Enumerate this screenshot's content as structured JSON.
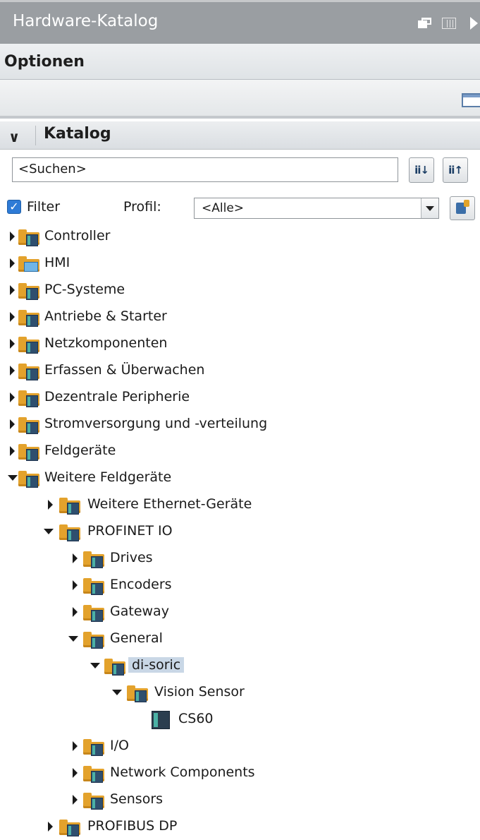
{
  "titlebar": {
    "title": "Hardware-Katalog",
    "icons": [
      "restore-icon",
      "columns-icon",
      "collapse-right-icon"
    ]
  },
  "options": {
    "header": "Optionen"
  },
  "catalog": {
    "header": "Katalog",
    "search": {
      "value": "<Suchen>"
    },
    "filter": {
      "checked": true,
      "label": "Filter"
    },
    "profile": {
      "label": "Profil:",
      "value": "<Alle>"
    }
  },
  "tree": {
    "items": [
      {
        "label": "Controller"
      },
      {
        "label": "HMI"
      },
      {
        "label": "PC-Systeme"
      },
      {
        "label": "Antriebe & Starter"
      },
      {
        "label": "Netzkomponenten"
      },
      {
        "label": "Erfassen & Überwachen"
      },
      {
        "label": "Dezentrale Peripherie"
      },
      {
        "label": "Stromversorgung und -verteilung"
      },
      {
        "label": "Feldgeräte"
      },
      {
        "label": "Weitere Feldgeräte"
      },
      {
        "label": "Weitere Ethernet-Geräte"
      },
      {
        "label": "PROFINET IO"
      },
      {
        "label": "Drives"
      },
      {
        "label": "Encoders"
      },
      {
        "label": "Gateway"
      },
      {
        "label": "General"
      },
      {
        "label": "di-soric"
      },
      {
        "label": "Vision Sensor"
      },
      {
        "label": "CS60"
      },
      {
        "label": "I/O"
      },
      {
        "label": "Network Components"
      },
      {
        "label": "Sensors"
      },
      {
        "label": "PROFIBUS DP"
      }
    ]
  }
}
